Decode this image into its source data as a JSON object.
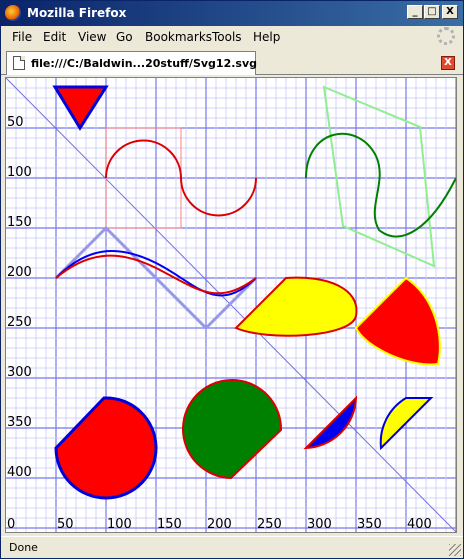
{
  "window": {
    "title": "Mozilla Firefox",
    "minimize_glyph": "_",
    "maximize_glyph": "□",
    "close_glyph": "X"
  },
  "menu": [
    "File",
    "Edit",
    "View",
    "Go",
    "Bookmarks",
    "Tools",
    "Help"
  ],
  "tab": {
    "label": "file:///C:/Baldwin...20stuff/Svg12.svg",
    "close_glyph": "X"
  },
  "status": {
    "text": "Done"
  },
  "canvas": {
    "x_labels": [
      "0",
      "50",
      "100",
      "150",
      "200",
      "250",
      "300",
      "350",
      "400"
    ],
    "y_labels": [
      "50",
      "100",
      "150",
      "200",
      "250",
      "300",
      "350",
      "400"
    ],
    "grid_minor_color": "#c8c8f8",
    "grid_major_color": "#7878ee"
  }
}
